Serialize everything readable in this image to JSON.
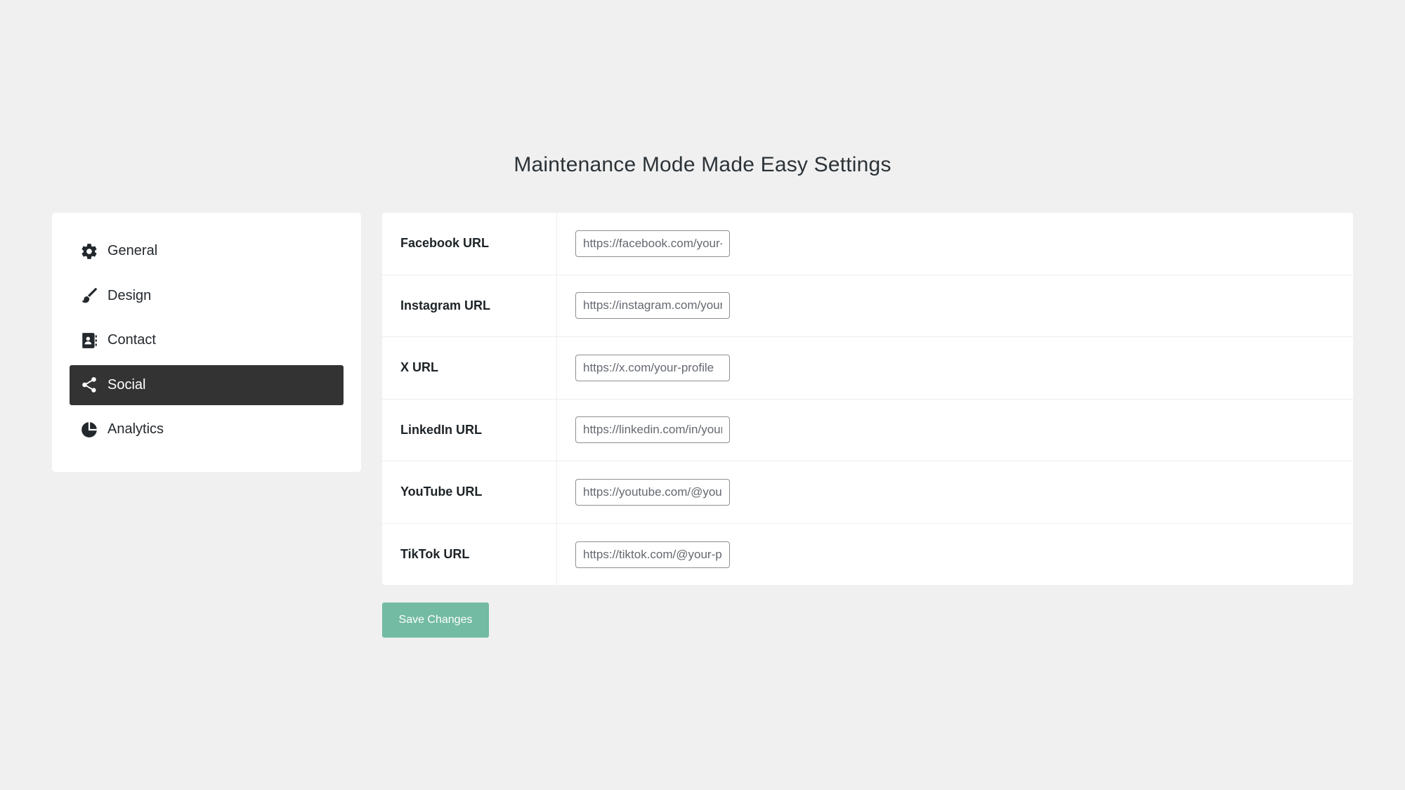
{
  "page": {
    "title": "Maintenance Mode Made Easy Settings"
  },
  "sidebar": {
    "items": [
      {
        "label": "General",
        "icon": "gear-icon",
        "active": false
      },
      {
        "label": "Design",
        "icon": "paintbrush-icon",
        "active": false
      },
      {
        "label": "Contact",
        "icon": "contact-book-icon",
        "active": false
      },
      {
        "label": "Social",
        "icon": "share-icon",
        "active": true
      },
      {
        "label": "Analytics",
        "icon": "pie-chart-icon",
        "active": false
      }
    ]
  },
  "form": {
    "fields": [
      {
        "label": "Facebook URL",
        "placeholder": "https://facebook.com/your-page",
        "value": ""
      },
      {
        "label": "Instagram URL",
        "placeholder": "https://instagram.com/your-profile",
        "value": ""
      },
      {
        "label": "X URL",
        "placeholder": "https://x.com/your-profile",
        "value": ""
      },
      {
        "label": "LinkedIn URL",
        "placeholder": "https://linkedin.com/in/your-profile",
        "value": ""
      },
      {
        "label": "YouTube URL",
        "placeholder": "https://youtube.com/@your-channel",
        "value": ""
      },
      {
        "label": "TikTok URL",
        "placeholder": "https://tiktok.com/@your-profile",
        "value": ""
      }
    ],
    "save_label": "Save Changes"
  },
  "colors": {
    "background": "#f0f0f0",
    "active_nav": "#333333",
    "save_button": "#73bba3"
  }
}
